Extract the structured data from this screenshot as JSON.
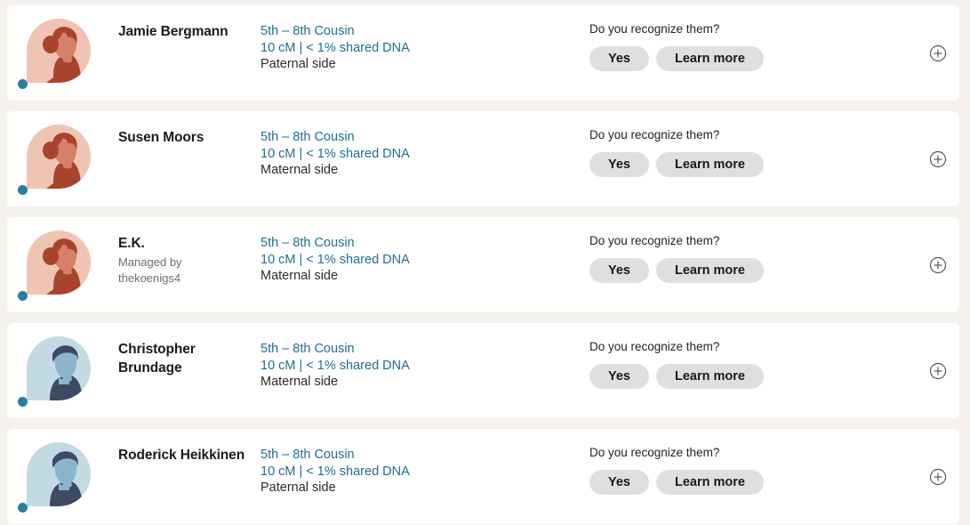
{
  "colors": {
    "page_background": "#f5f1ed",
    "card_background": "#ffffff",
    "link_text": "#1f6f8f",
    "status_dot": "#2b7f9e",
    "button_background": "#e0dfdd",
    "avatar_female_bg": "#f0c4b2",
    "avatar_female_hair": "#a8442c",
    "avatar_female_skin": "#d4806a",
    "avatar_male_bg": "#c3d9e4",
    "avatar_male_hair": "#3e4a63",
    "avatar_male_skin": "#8ab5cc"
  },
  "common": {
    "recognize_prompt": "Do you recognize them?",
    "yes_label": "Yes",
    "learn_more_label": "Learn more",
    "managed_by_prefix": "Managed by",
    "add_icon_name": "plus-circle-icon",
    "status_dot_name": "online-status-dot"
  },
  "matches": [
    {
      "name": "Jamie Bergmann",
      "managed_by": null,
      "relationship": "5th – 8th Cousin",
      "shared_dna": "10 cM | < 1% shared DNA",
      "side": "Paternal side",
      "avatar_type": "female",
      "recognize_prompt": "Do you recognize them?",
      "yes_label": "Yes",
      "learn_more_label": "Learn more"
    },
    {
      "name": "Susen Moors",
      "managed_by": null,
      "relationship": "5th – 8th Cousin",
      "shared_dna": "10 cM | < 1% shared DNA",
      "side": "Maternal side",
      "avatar_type": "female",
      "recognize_prompt": "Do you recognize them?",
      "yes_label": "Yes",
      "learn_more_label": "Learn more"
    },
    {
      "name": "E.K.",
      "managed_by": "Managed by thekoenigs4",
      "managed_by_line1": "Managed by",
      "managed_by_line2": "thekoenigs4",
      "relationship": "5th – 8th Cousin",
      "shared_dna": "10 cM | < 1% shared DNA",
      "side": "Maternal side",
      "avatar_type": "female",
      "recognize_prompt": "Do you recognize them?",
      "yes_label": "Yes",
      "learn_more_label": "Learn more"
    },
    {
      "name": "Christopher Brundage",
      "managed_by": null,
      "relationship": "5th – 8th Cousin",
      "shared_dna": "10 cM | < 1% shared DNA",
      "side": "Maternal side",
      "avatar_type": "male",
      "recognize_prompt": "Do you recognize them?",
      "yes_label": "Yes",
      "learn_more_label": "Learn more"
    },
    {
      "name": "Roderick Heikkinen",
      "managed_by": null,
      "relationship": "5th – 8th Cousin",
      "shared_dna": "10 cM | < 1% shared DNA",
      "side": "Paternal side",
      "avatar_type": "male",
      "recognize_prompt": "Do you recognize them?",
      "yes_label": "Yes",
      "learn_more_label": "Learn more"
    }
  ]
}
